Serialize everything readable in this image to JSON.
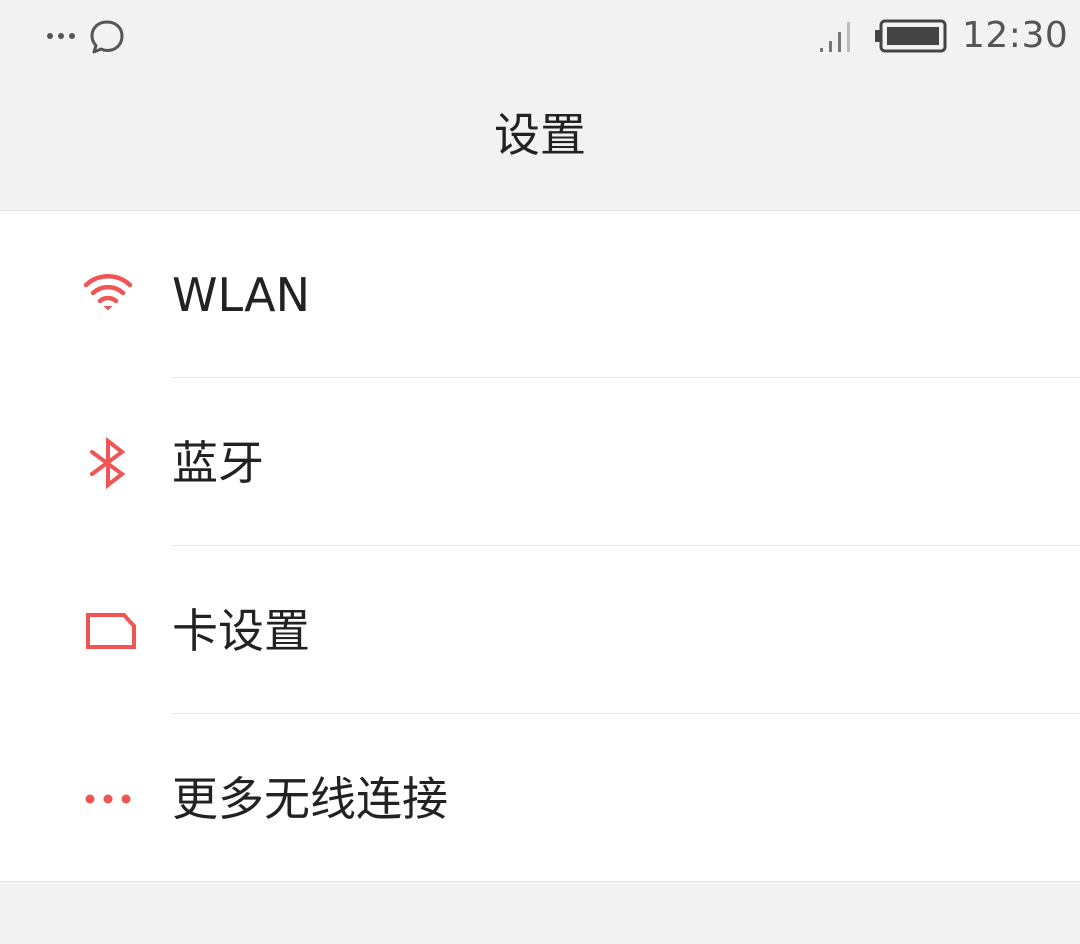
{
  "status_bar": {
    "time": "12:30",
    "left_icons": [
      "more-dots-icon",
      "message-icon"
    ],
    "right_icons": [
      "signal-icon",
      "battery-icon"
    ]
  },
  "header": {
    "title": "设置"
  },
  "settings": {
    "accent_color": "#f05454",
    "items": [
      {
        "label": "WLAN",
        "icon": "wifi-icon"
      },
      {
        "label": "蓝牙",
        "icon": "bluetooth-icon"
      },
      {
        "label": "卡设置",
        "icon": "sim-card-icon"
      },
      {
        "label": "更多无线连接",
        "icon": "more-dots-icon"
      }
    ]
  }
}
